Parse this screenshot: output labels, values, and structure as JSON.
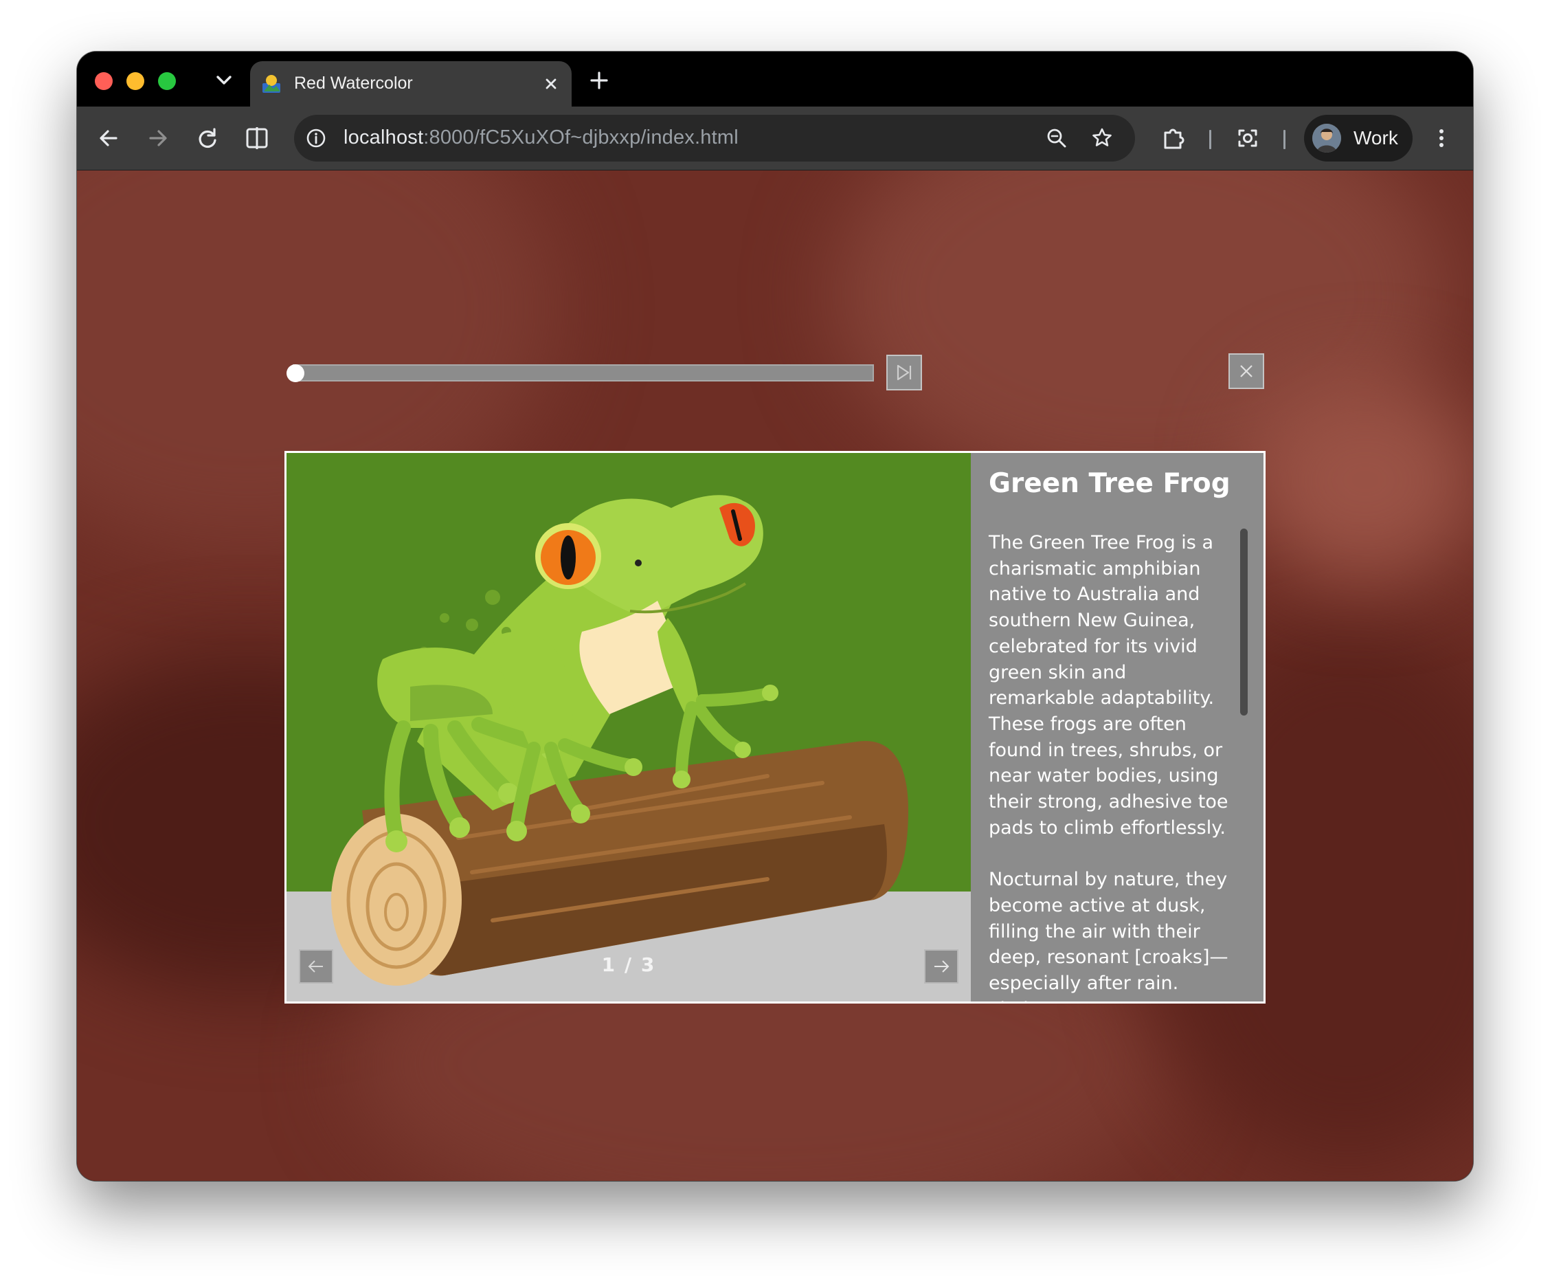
{
  "browser": {
    "tab_title": "Red Watercolor",
    "url_host": "localhost",
    "url_rest": ":8000/fC5XuXOf~djbxxp/index.html",
    "profile_label": "Work"
  },
  "slideshow": {
    "progress_fraction": 0.0,
    "counter": "1 / 3",
    "title": "Green Tree Frog",
    "paragraphs": [
      "The Green Tree Frog is a charismatic amphibian native to Australia and southern New Guinea, celebrated for its vivid green skin and remarkable adaptability. These frogs are often found in trees, shrubs, or near water bodies, using their strong, adhesive toe pads to climb effortlessly.",
      "Nocturnal by nature, they become active at dusk, filling the air with their deep, resonant [croaks]—especially after rain. Their"
    ]
  },
  "colors": {
    "background": "#6e2e25",
    "panel": "#8c8c8c",
    "image_green": "#538a21"
  }
}
